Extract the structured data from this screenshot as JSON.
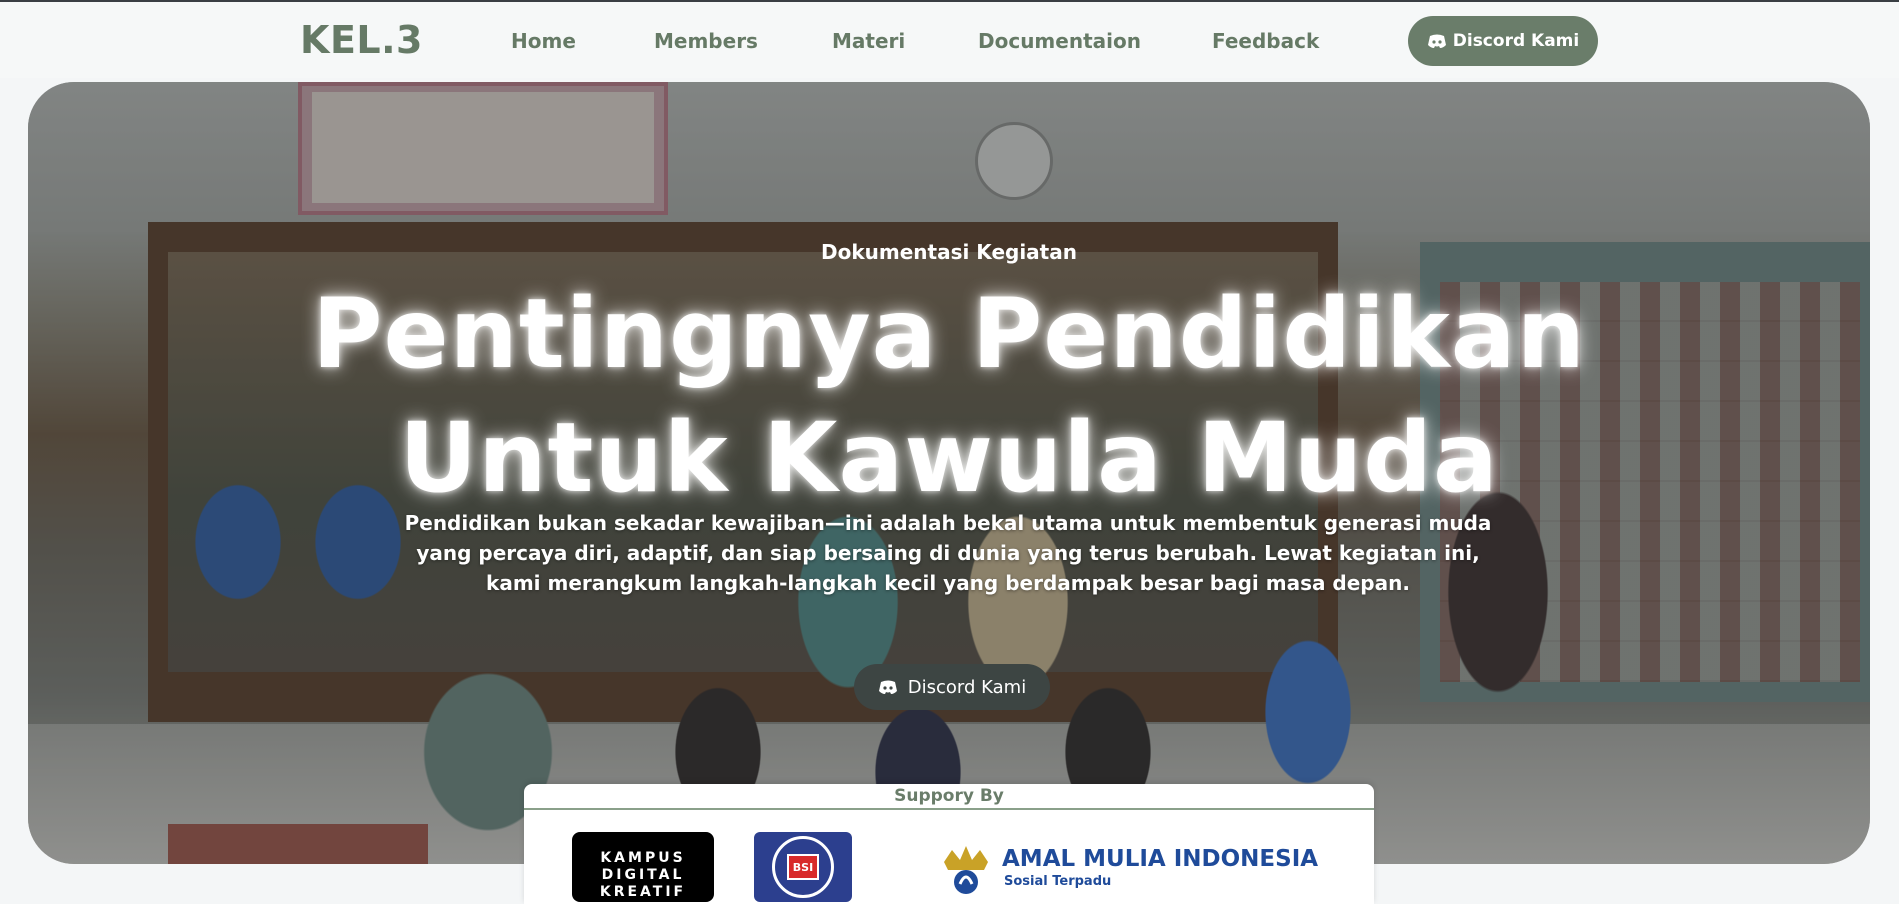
{
  "navbar": {
    "logo": "KEL.3",
    "links": [
      {
        "label": "Home"
      },
      {
        "label": "Members"
      },
      {
        "label": "Materi"
      },
      {
        "label": "Documentaion"
      },
      {
        "label": "Feedback"
      }
    ],
    "cta_label": "Discord Kami",
    "cta_icon": "discord-icon"
  },
  "hero": {
    "eyebrow": "Dokumentasi Kegiatan",
    "headline_line1": "Pentingnya Pendidikan",
    "headline_line2": "Untuk Kawula Muda",
    "subtext": "Pendidikan bukan sekadar kewajiban—ini adalah bekal utama untuk membentuk generasi muda yang percaya diri, adaptif, dan siap bersaing di dunia yang terus berubah. Lewat kegiatan ini, kami merangkum langkah-langkah kecil yang berdampak besar bagi masa depan.",
    "cta_label": "Discord Kami",
    "cta_icon": "discord-icon"
  },
  "support": {
    "title": "Suppory By",
    "logos": {
      "kampus_lines": [
        "KAMPUS",
        "DIGITAL",
        "KREATIF"
      ],
      "bsi_mark": "BSI",
      "ami_name": "AMAL MULIA INDONESIA",
      "ami_tagline": "Sosial Terpadu"
    }
  },
  "colors": {
    "accent": "#6a7d6a",
    "nav_text": "#667a66",
    "hero_button": "#3d4543"
  }
}
